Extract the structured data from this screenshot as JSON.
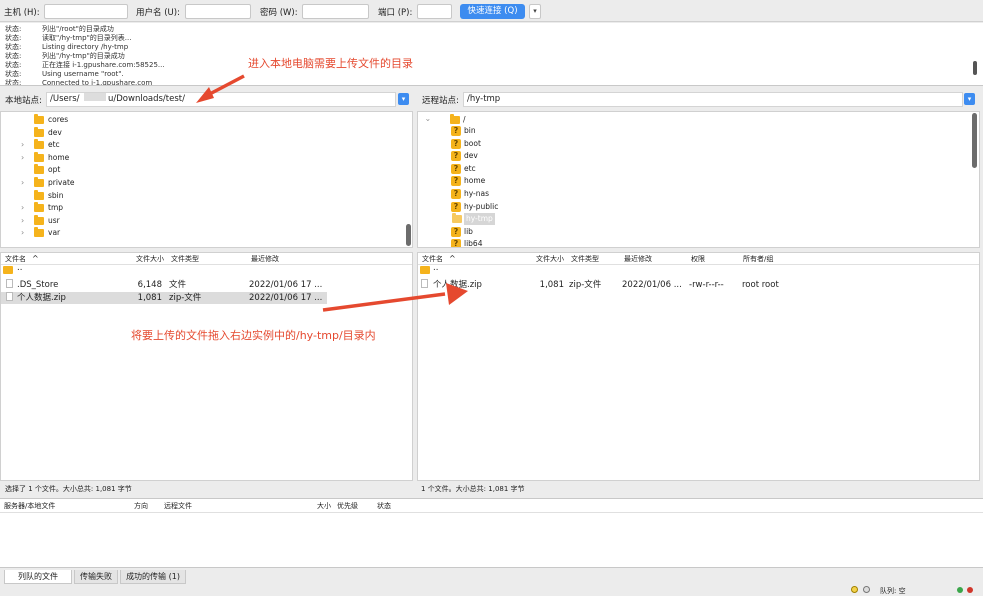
{
  "quickconnect": {
    "host_label": "主机 (H):",
    "user_label": "用户名 (U):",
    "pass_label": "密码 (W):",
    "port_label": "端口 (P):",
    "host_value": "",
    "user_value": "",
    "pass_value": "",
    "port_value": "",
    "connect_label": "快速连接 (Q)",
    "dropdown_icon": "▾"
  },
  "log": [
    {
      "k": "状态:",
      "v": "列出\"/root\"的目录成功"
    },
    {
      "k": "状态:",
      "v": "读取\"/hy-tmp\"的目录列表..."
    },
    {
      "k": "状态:",
      "v": "Listing directory /hy-tmp"
    },
    {
      "k": "状态:",
      "v": "列出\"/hy-tmp\"的目录成功"
    },
    {
      "k": "状态:",
      "v": "正在连接 i-1.gpushare.com:58525..."
    },
    {
      "k": "状态:",
      "v": "Using username \"root\"."
    },
    {
      "k": "状态:",
      "v": "Connected to i-1.gpushare.com"
    }
  ],
  "local": {
    "site_label": "本地站点:",
    "path_prefix": "/Users/",
    "path_suffix": "u/Downloads/test/",
    "tree": [
      {
        "name": "cores",
        "arrow": ""
      },
      {
        "name": "dev",
        "arrow": ""
      },
      {
        "name": "etc",
        "arrow": "›"
      },
      {
        "name": "home",
        "arrow": "›"
      },
      {
        "name": "opt",
        "arrow": ""
      },
      {
        "name": "private",
        "arrow": "›"
      },
      {
        "name": "sbin",
        "arrow": ""
      },
      {
        "name": "tmp",
        "arrow": "›"
      },
      {
        "name": "usr",
        "arrow": "›"
      },
      {
        "name": "var",
        "arrow": "›"
      }
    ],
    "headers": {
      "name": "文件名",
      "sort_icon": "^",
      "size": "文件大小",
      "type": "文件类型",
      "modified": "最近修改"
    },
    "files": [
      {
        "name": "..",
        "size": "",
        "type": "",
        "modified": ""
      },
      {
        "name": ".DS_Store",
        "size": "6,148",
        "type": "文件",
        "modified": "2022/01/06 17 ..."
      },
      {
        "name": "个人数据.zip",
        "size": "1,081",
        "type": "zip-文件",
        "modified": "2022/01/06 17 ..."
      }
    ],
    "status": "选择了 1 个文件。大小总共: 1,081 字节"
  },
  "remote": {
    "site_label": "远程站点:",
    "path": "/hy-tmp",
    "tree_root": "/",
    "tree": [
      {
        "name": "bin"
      },
      {
        "name": "boot"
      },
      {
        "name": "dev"
      },
      {
        "name": "etc"
      },
      {
        "name": "home"
      },
      {
        "name": "hy-nas"
      },
      {
        "name": "hy-public"
      },
      {
        "name": "hy-tmp"
      },
      {
        "name": "lib"
      },
      {
        "name": "lib64"
      }
    ],
    "headers": {
      "name": "文件名",
      "sort_icon": "^",
      "size": "文件大小",
      "type": "文件类型",
      "modified": "最近修改",
      "perm": "权限",
      "owner": "所有者/组"
    },
    "files": [
      {
        "name": "..",
        "size": "",
        "type": "",
        "modified": "",
        "perm": "",
        "owner": ""
      },
      {
        "name": "个人数据.zip",
        "size": "1,081",
        "type": "zip-文件",
        "modified": "2022/01/06 ...",
        "perm": "-rw-r--r--",
        "owner": "root root"
      }
    ],
    "status": "1 个文件。大小总共: 1,081 字节"
  },
  "queue": {
    "headers": {
      "server": "服务器/本地文件",
      "direction": "方向",
      "remote": "远程文件",
      "size": "大小",
      "priority": "优先级",
      "status": "状态"
    }
  },
  "tabs": [
    "列队的文件",
    "传输失败",
    "成功的传输 (1)"
  ],
  "bottom": {
    "queue_label": "队列: 空"
  },
  "annotations": {
    "top": "进入本地电脑需要上传文件的目录",
    "middle": "将要上传的文件拖入右边实例中的/hy-tmp/目录内"
  },
  "colors": {
    "accent": "#3d8cf0",
    "annotation": "#e5492f",
    "folder": "#f5b31c"
  }
}
